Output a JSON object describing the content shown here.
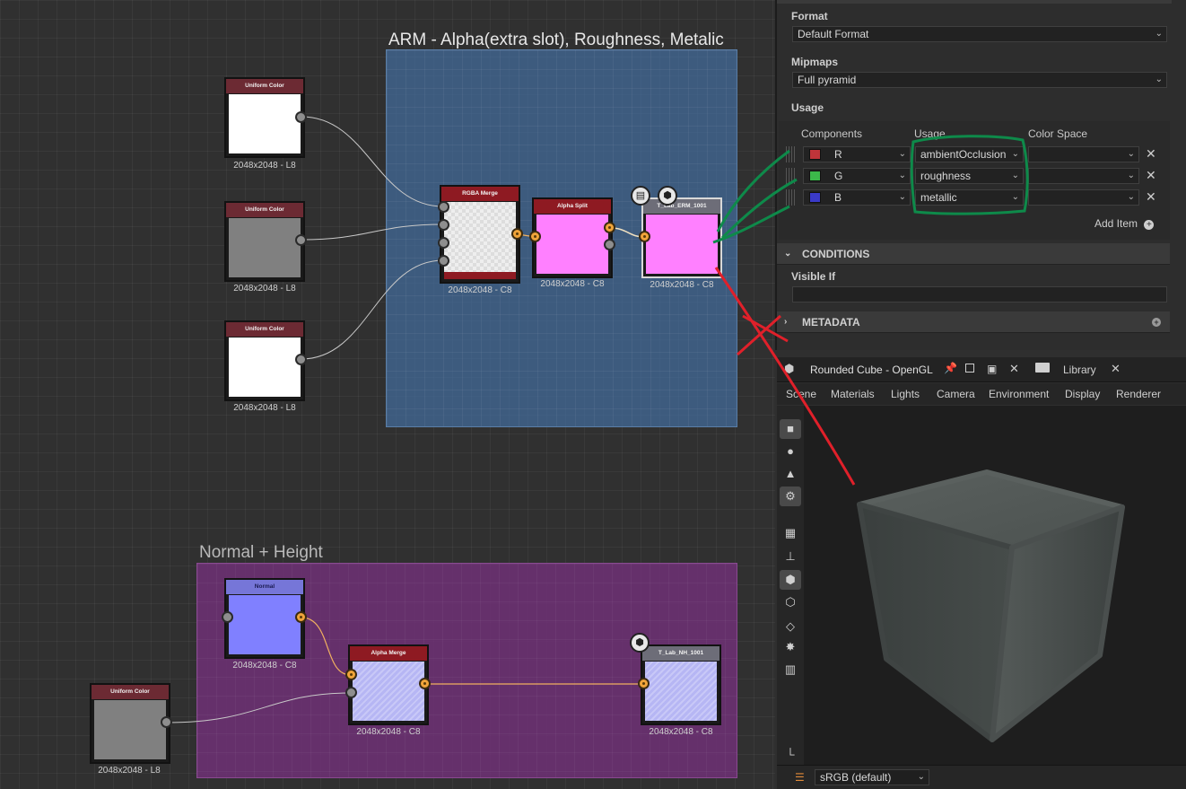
{
  "graph": {
    "frames": {
      "arm_title": "ARM - Alpha(extra slot), Roughness, Metalic",
      "normal_title": "Normal + Height"
    },
    "nodes": {
      "uc1": {
        "title": "Uniform Color",
        "res": "2048x2048 - L8"
      },
      "uc2": {
        "title": "Uniform Color",
        "res": "2048x2048 - L8"
      },
      "uc3": {
        "title": "Uniform Color",
        "res": "2048x2048 - L8"
      },
      "rgba": {
        "title": "RGBA Merge",
        "res": "2048x2048 - C8"
      },
      "asplit": {
        "title": "Alpha Split",
        "res": "2048x2048 - C8"
      },
      "out_arm": {
        "title": "T_Lab_ERM_1001",
        "res": "2048x2048 - C8"
      },
      "normal": {
        "title": "Normal",
        "res": "2048x2048 - C8"
      },
      "amerge": {
        "title": "Alpha Merge",
        "res": "2048x2048 - C8"
      },
      "out_nh": {
        "title": "T_Lab_NH_1001",
        "res": "2048x2048 - C8"
      },
      "uc4": {
        "title": "Uniform Color",
        "res": "2048x2048 - L8"
      }
    },
    "colors": {
      "header_red": "#8e1a22",
      "header_maroon": "#6c2a33",
      "header_blue": "#5a5ac8",
      "header_grey": "#6d6d78",
      "pink": "#ff80ff",
      "lavender": "#b6b6f4",
      "normal_blue": "#8080ff",
      "annotation_green": "#0e8a4a",
      "annotation_red": "#e0202a"
    }
  },
  "panel": {
    "format": {
      "label": "Format",
      "value": "Default Format"
    },
    "mipmaps": {
      "label": "Mipmaps",
      "value": "Full pyramid"
    },
    "usage_section": "Usage",
    "columns": {
      "components": "Components",
      "usage": "Usage",
      "color_space": "Color Space"
    },
    "rows": [
      {
        "component": "R",
        "color": "#c0343a",
        "usage": "ambientOcclusion",
        "color_space": ""
      },
      {
        "component": "G",
        "color": "#3cb84a",
        "usage": "roughness",
        "color_space": ""
      },
      {
        "component": "B",
        "color": "#3a3ac8",
        "usage": "metallic",
        "color_space": ""
      }
    ],
    "add_item": "Add Item",
    "conditions": {
      "title": "CONDITIONS",
      "visible_if_label": "Visible If",
      "visible_if_value": ""
    },
    "metadata": {
      "title": "METADATA"
    }
  },
  "viewport": {
    "tab_title": "Rounded Cube - OpenGL",
    "library_tab": "Library",
    "menu": [
      "Scene",
      "Materials",
      "Lights",
      "Camera",
      "Environment",
      "Display",
      "Renderer"
    ],
    "color_space": "sRGB (default)"
  }
}
